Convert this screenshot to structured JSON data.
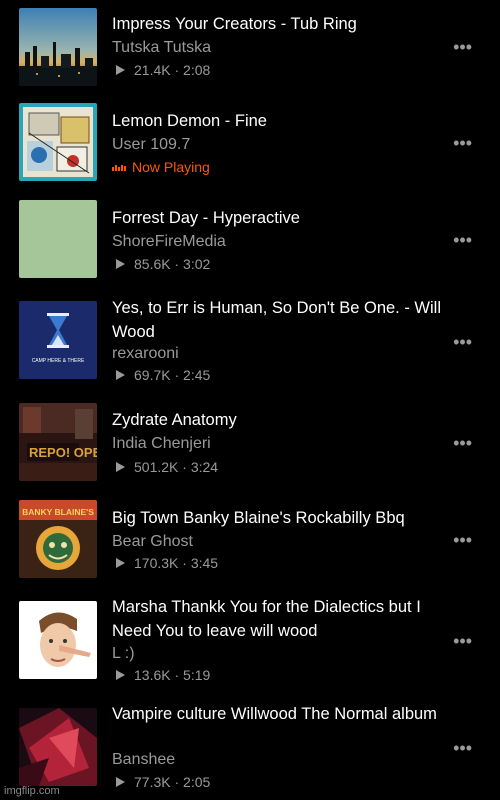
{
  "tracks": [
    {
      "title": "Impress Your Creators - Tub Ring",
      "artist": "Tutska Tutska",
      "plays": "21.4K",
      "duration": "2:08",
      "art": "city-night-skyline"
    },
    {
      "title": "Lemon Demon - Fine",
      "artist": "User 109.7",
      "status": "Now Playing",
      "art": "lemon-demon-collage"
    },
    {
      "title": "Forrest Day - Hyperactive",
      "artist": "ShoreFireMedia",
      "plays": "85.6K",
      "duration": "3:02",
      "art": "plain-green"
    },
    {
      "title": "Yes, to Err is Human, So Don't Be One. - Will Wood",
      "artist": "rexarooni",
      "plays": "69.7K",
      "duration": "2:45",
      "art": "hourglass",
      "art_text": "CAMP HERE & THERE"
    },
    {
      "title": "Zydrate Anatomy",
      "artist": "India Chenjeri",
      "plays": "501.2K",
      "duration": "3:24",
      "art": "repo-opera-poster",
      "art_text": "REPO! OPERA"
    },
    {
      "title": "Big Town Banky Blaine's Rockabilly Bbq",
      "artist": "Bear Ghost",
      "plays": "170.3K",
      "duration": "3:45",
      "art": "banky-blaine-poster",
      "art_text": "BANKY BLAINE'S"
    },
    {
      "title": "Marsha Thankk You for the Dialectics but I Need You to leave will wood",
      "artist": "L :)",
      "plays": "13.6K",
      "duration": "5:19",
      "art": "face-long-nose"
    },
    {
      "title": "Vampire culture Willwood The Normal album",
      "artist": "Banshee",
      "plays": "77.3K",
      "duration": "2:05",
      "art": "red-abstract"
    }
  ],
  "more_glyph": "•••",
  "separator": "·",
  "watermark": "imgflip.com",
  "colors": {
    "background": "#000000",
    "accent": "#ff5500",
    "secondary_text": "#9a9a9a"
  }
}
